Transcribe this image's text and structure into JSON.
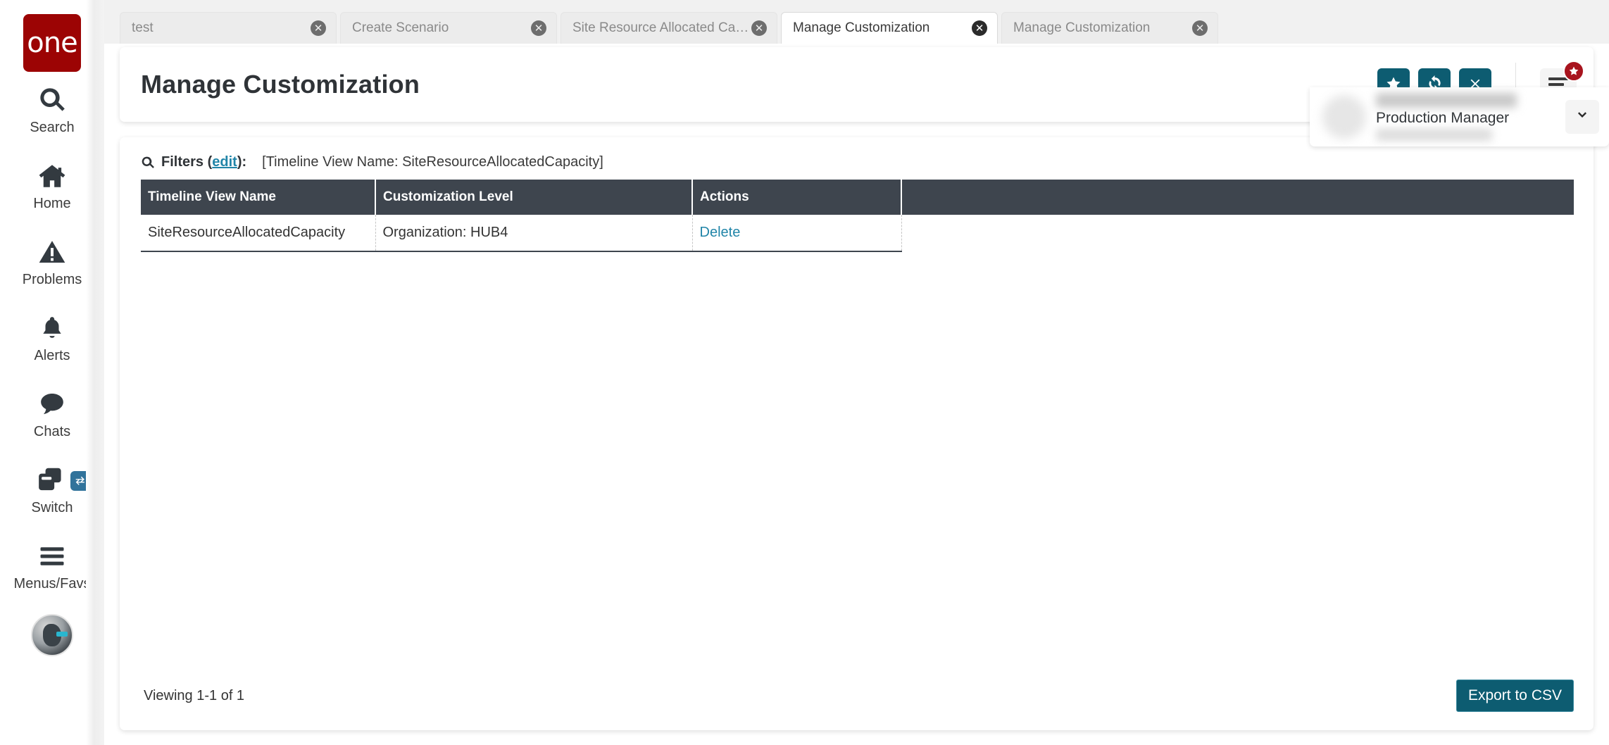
{
  "brand": {
    "logo_text": "one",
    "logo_color": "#9c0404"
  },
  "theme": {
    "accent": "#0d5c71",
    "link": "#2185a8",
    "table_header_bg": "#3e454e",
    "badge_red": "#a8141e"
  },
  "sidebar": {
    "items": [
      {
        "label": "Search",
        "icon": "search-icon"
      },
      {
        "label": "Home",
        "icon": "home-icon"
      },
      {
        "label": "Problems",
        "icon": "warning-triangle-icon"
      },
      {
        "label": "Alerts",
        "icon": "bell-icon"
      },
      {
        "label": "Chats",
        "icon": "chat-bubble-icon"
      },
      {
        "label": "Switch",
        "icon": "switch-windows-icon"
      },
      {
        "label": "Menus/Favs",
        "icon": "hamburger-icon"
      }
    ]
  },
  "tabs": [
    {
      "label": "test",
      "active": false
    },
    {
      "label": "Create Scenario",
      "active": false
    },
    {
      "label": "Site Resource Allocated Capacity",
      "active": false
    },
    {
      "label": "Manage Customization",
      "active": true
    },
    {
      "label": "Manage Customization",
      "active": false
    }
  ],
  "header": {
    "title": "Manage Customization",
    "buttons": [
      {
        "name": "favorite-button",
        "icon": "star-icon"
      },
      {
        "name": "refresh-button",
        "icon": "refresh-icon"
      },
      {
        "name": "close-button",
        "icon": "close-x-icon"
      }
    ],
    "menu_icon": "hamburger-icon",
    "menu_badge_icon": "star-icon"
  },
  "user": {
    "name": "",
    "role": "Production Manager",
    "sub": "",
    "caret_icon": "chevron-down-icon"
  },
  "filters": {
    "icon": "search-icon",
    "label": "Filters (",
    "edit_link": "edit",
    "label_suffix": "):",
    "value": "[Timeline View Name: SiteResourceAllocatedCapacity]"
  },
  "table": {
    "columns": [
      "Timeline View Name",
      "Customization Level",
      "Actions",
      ""
    ],
    "rows": [
      {
        "timeline_view_name": "SiteResourceAllocatedCapacity",
        "customization_level": "Organization: HUB4",
        "action_label": "Delete"
      }
    ]
  },
  "footer": {
    "viewing": "Viewing 1-1 of 1",
    "export_label": "Export to CSV"
  }
}
